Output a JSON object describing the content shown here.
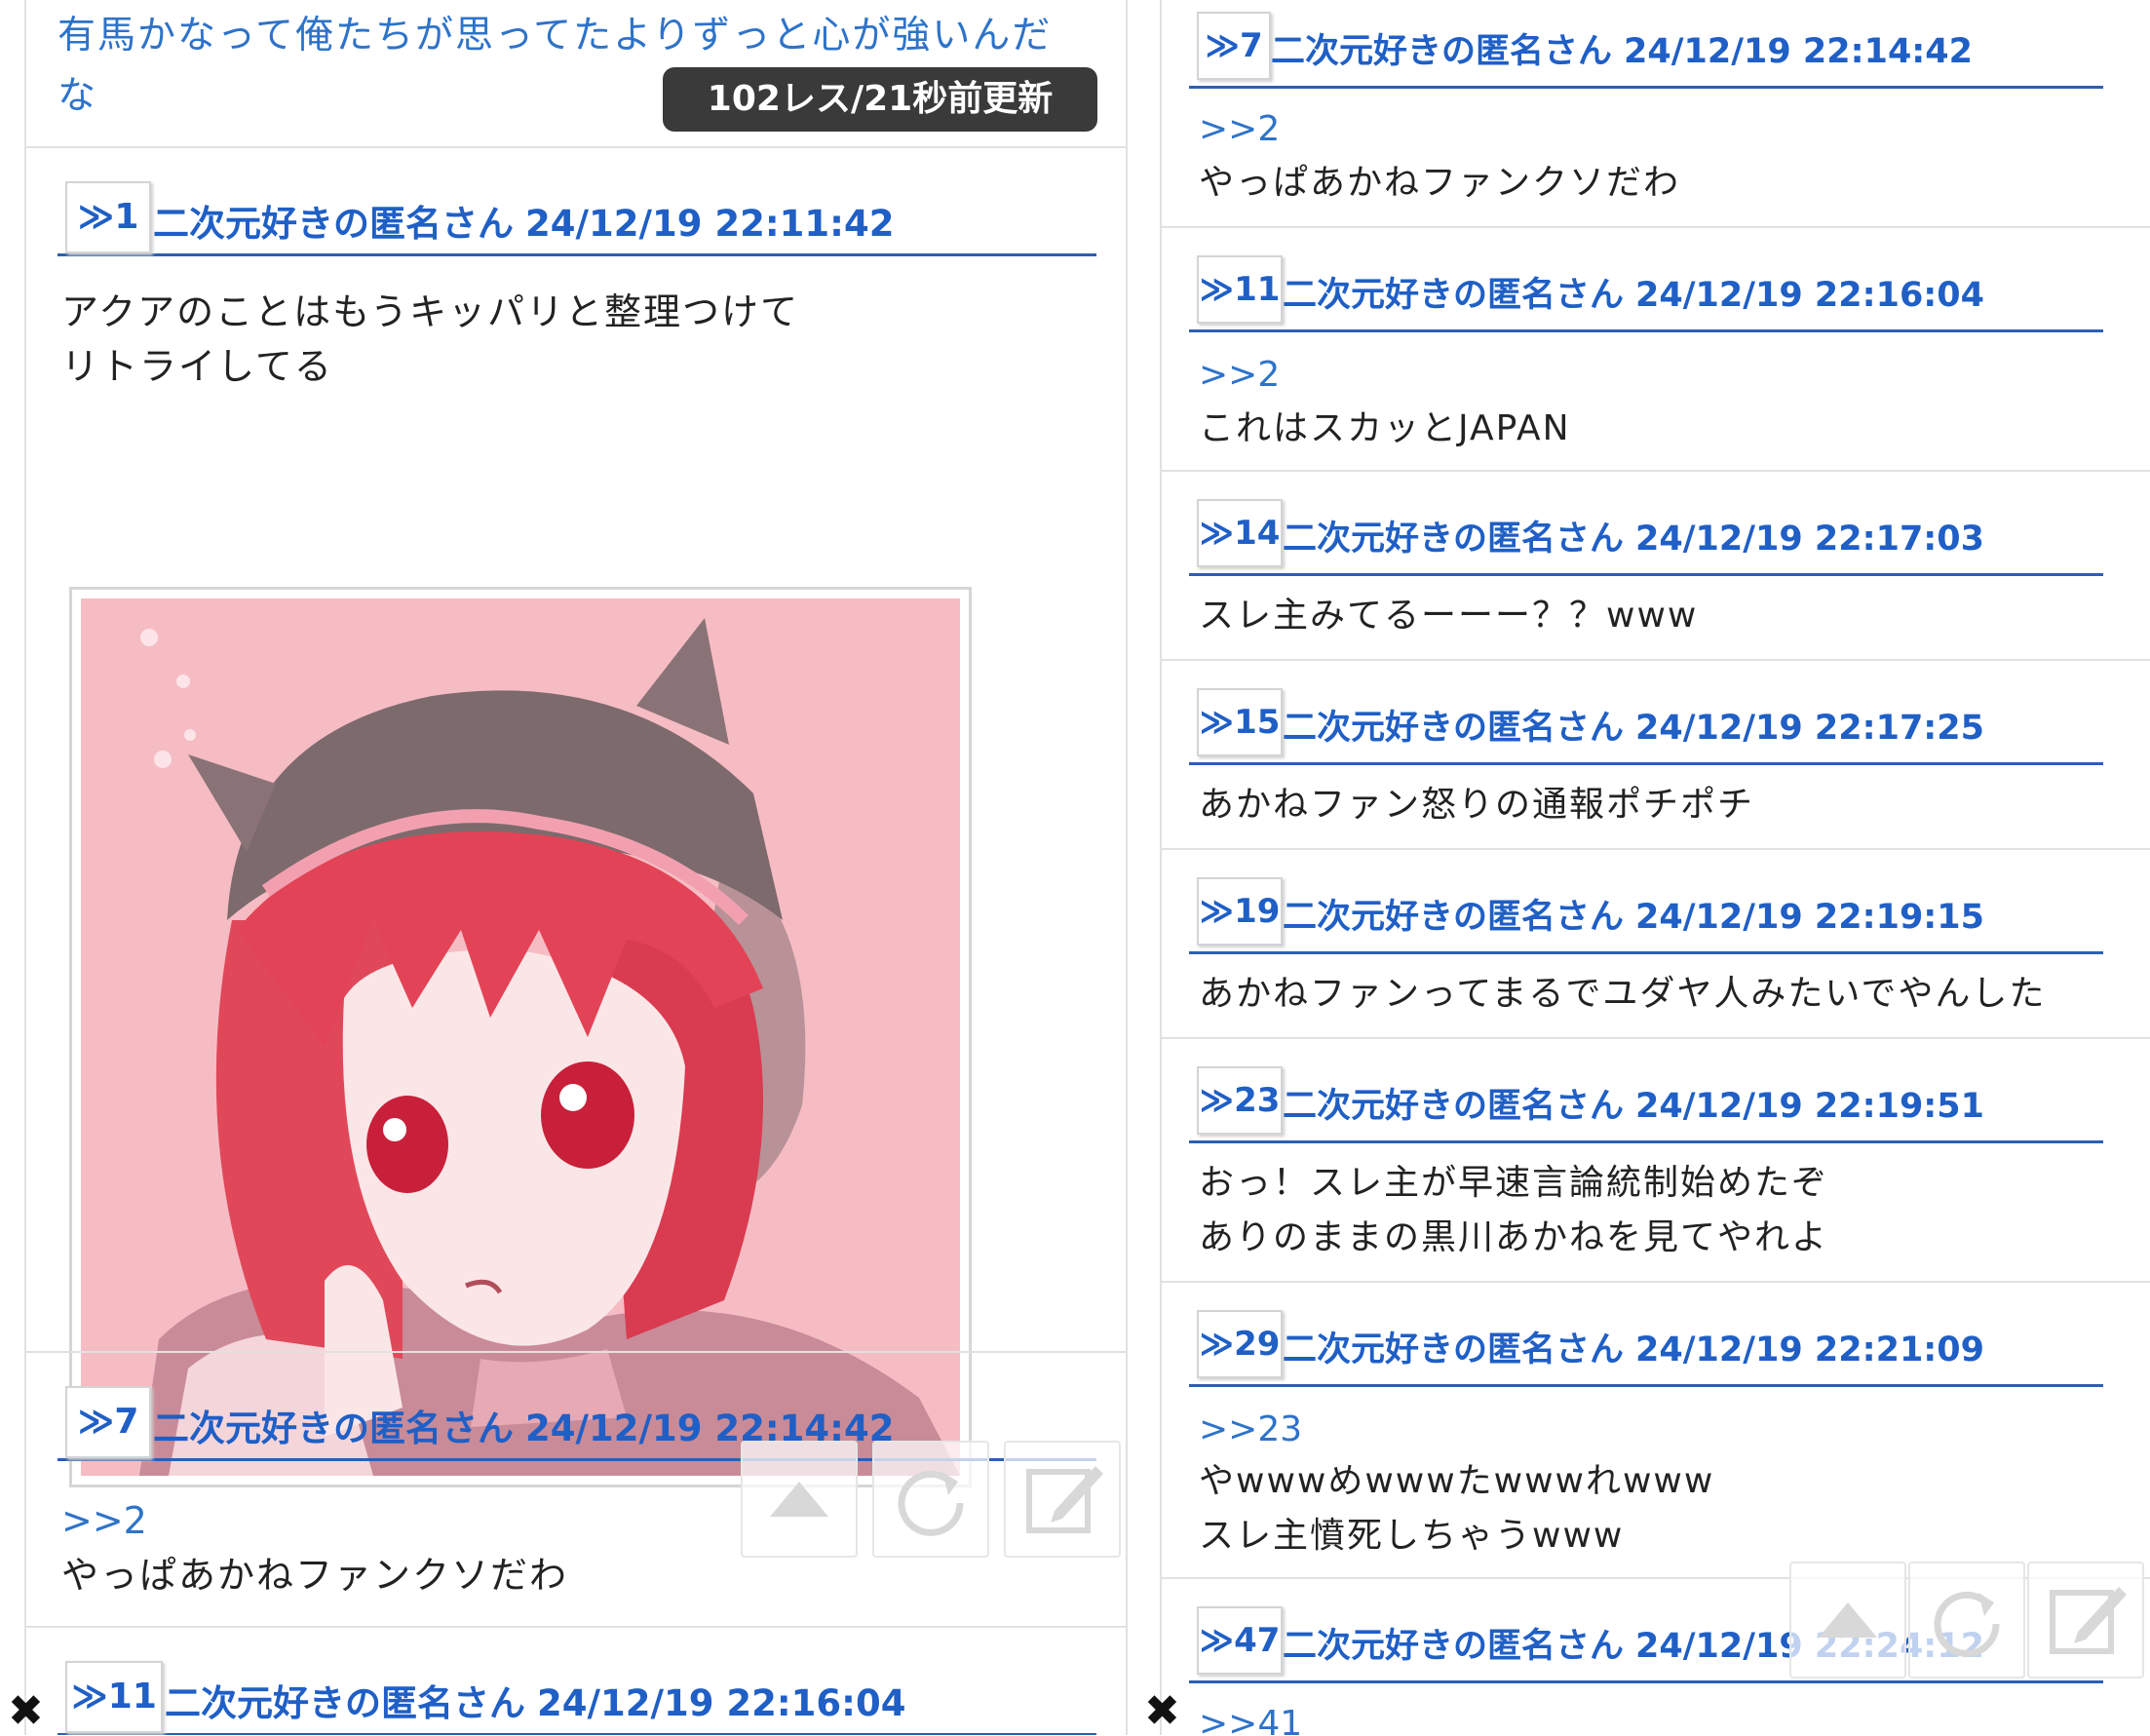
{
  "thread": {
    "title": "有馬かなって俺たちが思ってたよりずっと心が強いんだな",
    "title_line1": "有馬かなって俺たちが思ってたよりずっと心が強いんだ",
    "title_line2": "な",
    "status_badge": "102レス/21秒前更新"
  },
  "left_posts": [
    {
      "num": "≫1",
      "name": "二次元好きの匿名さん",
      "date": "24/12/19 22:11:42",
      "body": "アクアのことはもうキッパリと整理つけて\nリトライしてる",
      "has_image": true
    },
    {
      "num": "≫7",
      "name": "二次元好きの匿名さん",
      "date": "24/12/19 22:14:42",
      "anchor": ">>2",
      "body": "やっぱあかねファンクソだわ"
    },
    {
      "num": "≫11",
      "name": "二次元好きの匿名さん",
      "date": "24/12/19 22:16:04"
    }
  ],
  "right_posts": [
    {
      "num": "≫7",
      "name": "二次元好きの匿名さん",
      "date": "24/12/19 22:14:42",
      "anchor": ">>2",
      "body": "やっぱあかねファンクソだわ"
    },
    {
      "num": "≫11",
      "name": "二次元好きの匿名さん",
      "date": "24/12/19 22:16:04",
      "anchor": ">>2",
      "body": "これはスカッとJAPAN"
    },
    {
      "num": "≫14",
      "name": "二次元好きの匿名さん",
      "date": "24/12/19 22:17:03",
      "body": "スレ主みてるーーー？？www"
    },
    {
      "num": "≫15",
      "name": "二次元好きの匿名さん",
      "date": "24/12/19 22:17:25",
      "body": "あかねファン怒りの通報ポチポチ"
    },
    {
      "num": "≫19",
      "name": "二次元好きの匿名さん",
      "date": "24/12/19 22:19:15",
      "body": "あかねファンってまるでユダヤ人みたいでやんした"
    },
    {
      "num": "≫23",
      "name": "二次元好きの匿名さん",
      "date": "24/12/19 22:19:51",
      "body": "おっ！スレ主が早速言論統制始めたぞ\nありのままの黒川あかねを見てやれよ"
    },
    {
      "num": "≫29",
      "name": "二次元好きの匿名さん",
      "date": "24/12/19 22:21:09",
      "anchor": ">>23",
      "body": "やwwwめwwwたwwwれwww\nスレ主憤死しちゃうwww"
    },
    {
      "num": "≫47",
      "name": "二次元好きの匿名さん",
      "date": "24/12/19 22:24:12",
      "anchor": ">>41"
    }
  ],
  "floating_buttons": {
    "icons": [
      "triangle-up-icon",
      "reload-icon",
      "edit-icon"
    ]
  },
  "close_label": "✖",
  "colors": {
    "link_blue": "#1f5fc6",
    "underline_blue": "#2b5fb3",
    "badge_bg": "#3a3a3a"
  }
}
